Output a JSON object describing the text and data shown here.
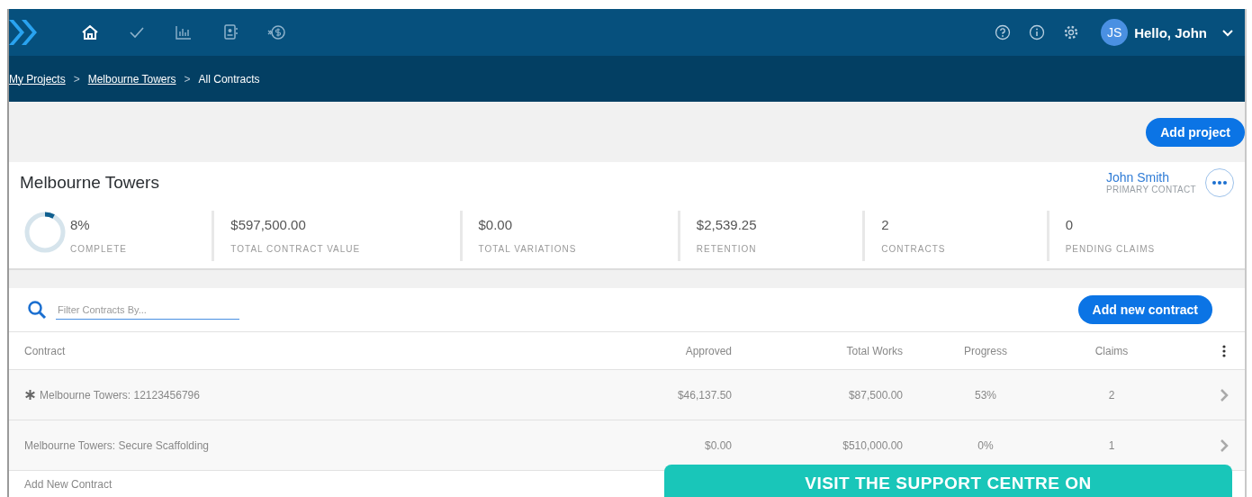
{
  "nav": {
    "items": [
      {
        "kind": "home",
        "selected": true
      },
      {
        "kind": "check",
        "selected": false
      },
      {
        "kind": "chart",
        "selected": false
      },
      {
        "kind": "contact",
        "selected": false
      },
      {
        "kind": "payment",
        "selected": false
      }
    ],
    "avatar": "JS",
    "greeting": "Hello, John"
  },
  "breadcrumb": [
    {
      "label": "My Projects",
      "kind": "link"
    },
    {
      "label": ">",
      "kind": "separator"
    },
    {
      "label": "Melbourne Towers",
      "kind": "link"
    },
    {
      "label": ">",
      "kind": "separator"
    },
    {
      "label": "All Contracts",
      "kind": "current"
    }
  ],
  "add_project": "Add project",
  "project": {
    "title": "Melbourne Towers",
    "contact_name": "John Smith",
    "contact_role": "PRIMARY CONTACT",
    "progress": {
      "level": 0.08,
      "value": "8%",
      "label": "COMPLETE"
    },
    "stats": [
      {
        "value": "$597,500.00",
        "label": "TOTAL CONTRACT VALUE"
      },
      {
        "value": "$0.00",
        "label": "TOTAL VARIATIONS"
      },
      {
        "value": "$2,539.25",
        "label": "RETENTION"
      },
      {
        "value": "2",
        "label": "CONTRACTS"
      },
      {
        "value": "0",
        "label": "PENDING CLAIMS"
      }
    ]
  },
  "filter": {
    "placeholder": "Filter Contracts By..."
  },
  "add_contract": "Add new contract",
  "table": {
    "columns": [
      "Contract",
      "Approved",
      "Total Works",
      "Progress",
      "Claims"
    ],
    "rows": [
      {
        "starred": true,
        "cells": [
          "Melbourne Towers: 12123456796",
          "$46,137.50",
          "$87,500.00",
          "53%",
          "2"
        ]
      },
      {
        "starred": false,
        "cells": [
          "Melbourne Towers: Secure Scaffolding",
          "$0.00",
          "$510,000.00",
          "0%",
          "1"
        ]
      }
    ],
    "footer": "Add New Contract"
  },
  "banner": "VISIT THE SUPPORT CENTRE ON"
}
